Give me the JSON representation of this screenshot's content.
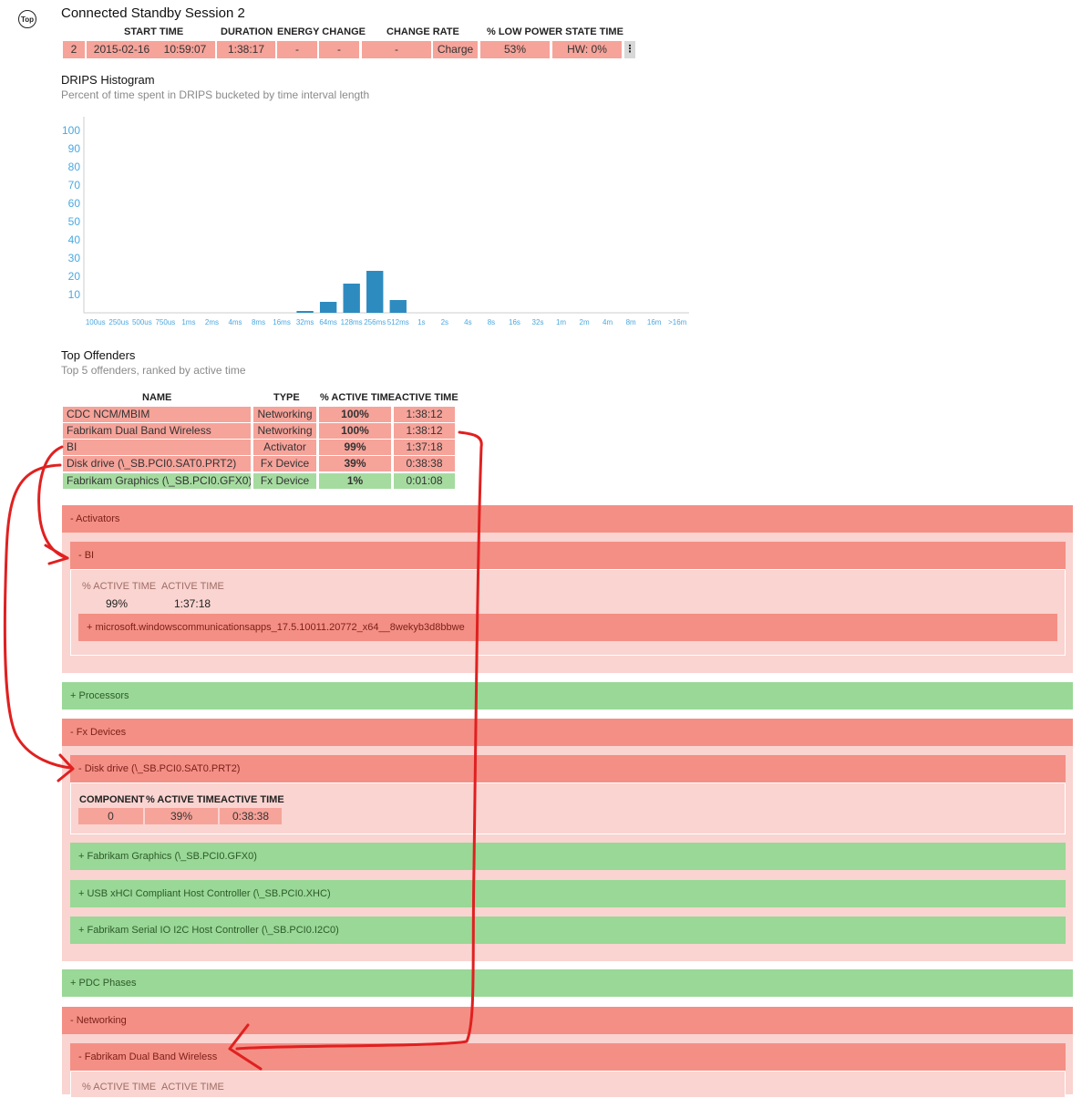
{
  "header": {
    "top_button": "Top",
    "title": "Connected Standby Session 2"
  },
  "session": {
    "columns": [
      "START TIME",
      "DURATION",
      "ENERGY CHANGE",
      "CHANGE RATE",
      "% LOW POWER STATE TIME"
    ],
    "row": {
      "index": "2",
      "start_date": "2015-02-16",
      "start_time": "10:59:07",
      "duration": "1:38:17",
      "energy_a": "-",
      "energy_b": "-",
      "change_rate": "-",
      "charge": "Charge",
      "low_power": "53%",
      "hw": "HW: 0%"
    },
    "more_icon": "ellipsis-vertical-icon"
  },
  "histogram": {
    "title": "DRIPS Histogram",
    "subtitle": "Percent of time spent in DRIPS bucketed by time interval length"
  },
  "chart_data": {
    "type": "bar",
    "title": "DRIPS Histogram",
    "subtitle": "Percent of time spent in DRIPS bucketed by time interval length",
    "categories": [
      "100us",
      "250us",
      "500us",
      "750us",
      "1ms",
      "2ms",
      "4ms",
      "8ms",
      "16ms",
      "32ms",
      "64ms",
      "128ms",
      "256ms",
      "512ms",
      "1s",
      "2s",
      "4s",
      "8s",
      "16s",
      "32s",
      "1m",
      "2m",
      "4m",
      "8m",
      "16m",
      ">16m"
    ],
    "values": [
      0,
      0,
      0,
      0,
      0,
      0,
      0,
      0,
      0,
      1,
      6,
      16,
      23,
      7,
      0,
      0,
      0,
      0,
      0,
      0,
      0,
      0,
      0,
      0,
      0,
      0
    ],
    "y_ticks": [
      10,
      20,
      30,
      40,
      50,
      60,
      70,
      80,
      90,
      100
    ],
    "ylim": [
      0,
      100
    ],
    "bar_color": "#2e8bc0",
    "tick_color": "#4aa8e0",
    "grid": false
  },
  "offenders": {
    "title": "Top Offenders",
    "subtitle": "Top 5 offenders, ranked by active time",
    "columns": [
      "NAME",
      "TYPE",
      "% ACTIVE TIME",
      "ACTIVE TIME"
    ],
    "rows": [
      {
        "name": "CDC NCM/MBIM",
        "type": "Networking",
        "pct": "100%",
        "time": "1:38:12",
        "status": "red"
      },
      {
        "name": "Fabrikam Dual Band Wireless",
        "type": "Networking",
        "pct": "100%",
        "time": "1:38:12",
        "status": "red"
      },
      {
        "name": "BI",
        "type": "Activator",
        "pct": "99%",
        "time": "1:37:18",
        "status": "red"
      },
      {
        "name": "Disk drive (\\_SB.PCI0.SAT0.PRT2)",
        "type": "Fx Device",
        "pct": "39%",
        "time": "0:38:38",
        "status": "red"
      },
      {
        "name": "Fabrikam Graphics (\\_SB.PCI0.GFX0)",
        "type": "Fx Device",
        "pct": "1%",
        "time": "0:01:08",
        "status": "green"
      }
    ]
  },
  "sections": {
    "activators": {
      "label": "-  Activators",
      "bi": {
        "label": "-  BI",
        "pct_head": "% ACTIVE TIME",
        "time_head": "ACTIVE TIME",
        "pct": "99%",
        "time": "1:37:18",
        "app": "+  microsoft.windowscommunicationsapps_17.5.10011.20772_x64__8wekyb3d8bbwe"
      }
    },
    "processors": {
      "label": "+  Processors"
    },
    "fx_devices": {
      "label": "-  Fx Devices",
      "disk": {
        "label": "-  Disk drive (\\_SB.PCI0.SAT0.PRT2)",
        "columns": [
          "COMPONENT",
          "% ACTIVE TIME",
          "ACTIVE TIME"
        ],
        "component": "0",
        "pct": "39%",
        "time": "0:38:38"
      },
      "graphics": "+  Fabrikam Graphics (\\_SB.PCI0.GFX0)",
      "usb": "+  USB xHCI Compliant Host Controller (\\_SB.PCI0.XHC)",
      "serial": "+  Fabrikam Serial IO I2C Host Controller (\\_SB.PCI0.I2C0)"
    },
    "pdc": {
      "label": "+  PDC Phases"
    },
    "networking": {
      "label": "-  Networking",
      "wireless": {
        "label": "-  Fabrikam Dual Band Wireless",
        "pct_head": "% ACTIVE TIME",
        "time_head": "ACTIVE TIME"
      }
    }
  },
  "colors": {
    "red_cell": "#f6a39a",
    "red_bar": "#f48f85",
    "green_bar": "#99d896",
    "annotation": "#e02020"
  }
}
